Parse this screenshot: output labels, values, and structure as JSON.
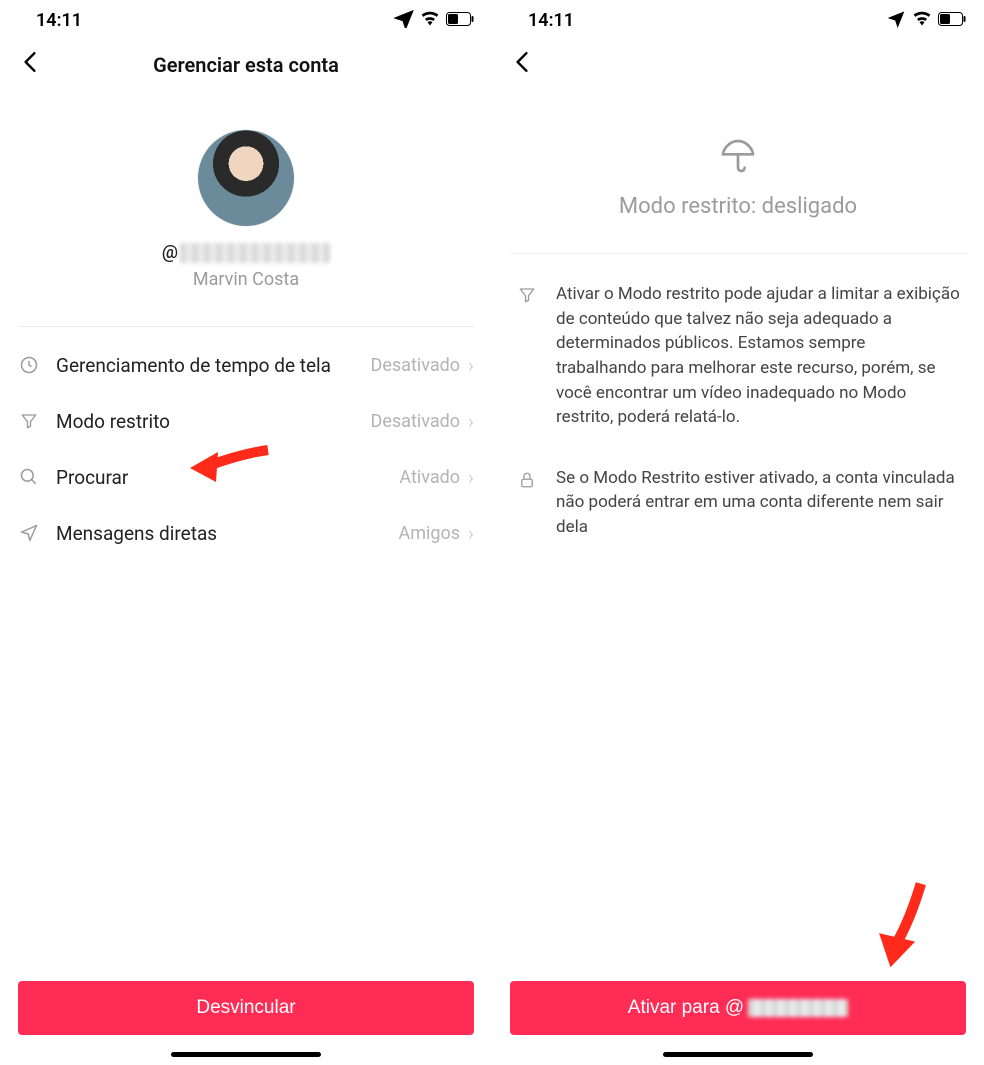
{
  "status": {
    "time": "14:11"
  },
  "colors": {
    "accent": "#ff2d55"
  },
  "left": {
    "title": "Gerenciar esta conta",
    "handle_prefix": "@",
    "display_name": "Marvin Costa",
    "rows": [
      {
        "icon": "clock",
        "label": "Gerenciamento de tempo de tela",
        "value": "Desativado"
      },
      {
        "icon": "filter",
        "label": "Modo restrito",
        "value": "Desativado"
      },
      {
        "icon": "search",
        "label": "Procurar",
        "value": "Ativado"
      },
      {
        "icon": "send",
        "label": "Mensagens diretas",
        "value": "Amigos"
      }
    ],
    "unlink_label": "Desvincular"
  },
  "right": {
    "hero_title": "Modo restrito: desligado",
    "info1": "Ativar o Modo restrito pode ajudar a limitar a exibição de conteúdo que talvez não seja adequado a determinados públicos. Estamos sempre trabalhando para melhorar este recurso, porém, se você encontrar um vídeo inadequado no Modo restrito, poderá relatá-lo.",
    "info2": "Se o Modo Restrito estiver ativado, a conta vinculada não poderá entrar em uma conta diferente nem sair dela",
    "activate_prefix": "Ativar para @"
  }
}
